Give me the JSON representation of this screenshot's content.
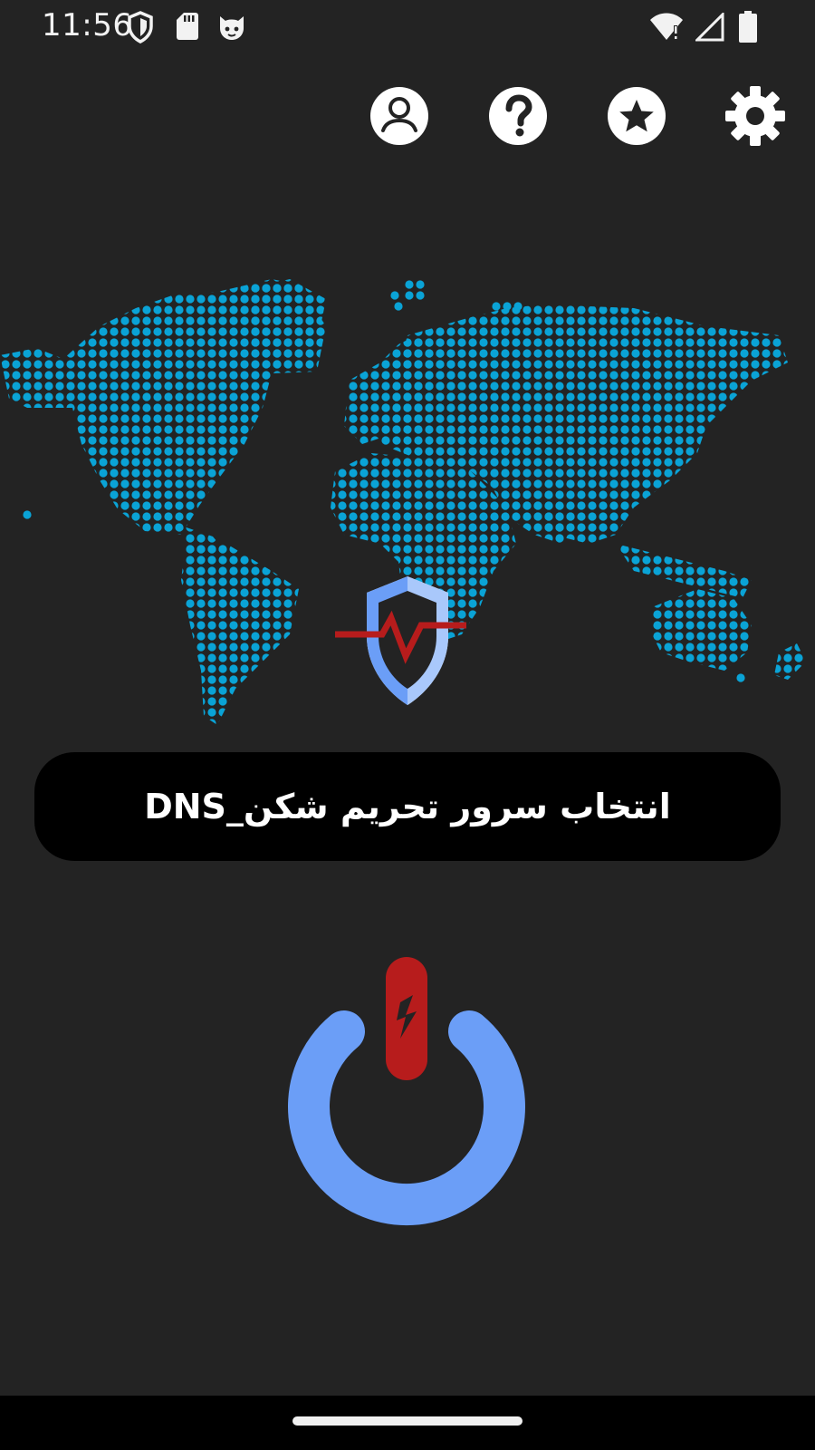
{
  "status_bar": {
    "time": "11:56",
    "icons_left": [
      "shield-status-icon",
      "sd-card-icon",
      "cat-app-icon"
    ],
    "icons_right": [
      "wifi-alert-icon",
      "cellular-signal-icon",
      "battery-icon"
    ]
  },
  "top_actions": [
    {
      "name": "account-icon"
    },
    {
      "name": "help-icon"
    },
    {
      "name": "rate-star-icon"
    },
    {
      "name": "settings-gear-icon"
    }
  ],
  "server_selector": {
    "label": "انتخاب سرور تحریم شکن_DNS"
  },
  "colors": {
    "background": "#232323",
    "map_dots": "#0aa3d6",
    "accent_blue": "#6b9ef7",
    "accent_red": "#b71c1c",
    "selector_bg": "#000000"
  }
}
